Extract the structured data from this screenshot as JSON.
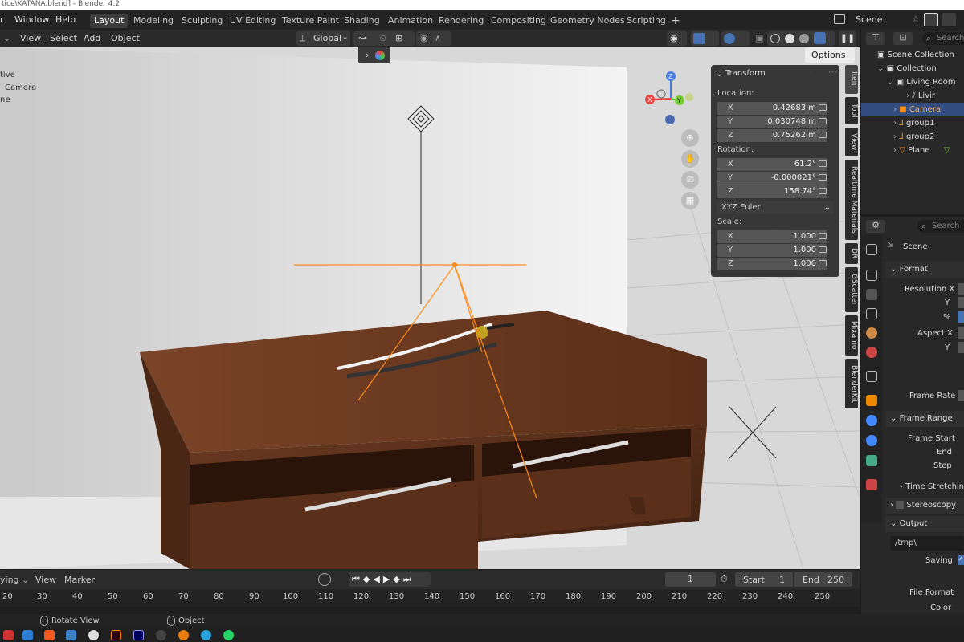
{
  "window": {
    "title": "tice\\KATANA.blend] - Blender 4.2"
  },
  "menus": [
    {
      "label": "r"
    },
    {
      "label": "Window"
    },
    {
      "label": "Help"
    }
  ],
  "workspaces": [
    {
      "label": "Layout",
      "active": true
    },
    {
      "label": "Modeling"
    },
    {
      "label": "Sculpting"
    },
    {
      "label": "UV Editing"
    },
    {
      "label": "Texture Paint"
    },
    {
      "label": "Shading"
    },
    {
      "label": "Animation"
    },
    {
      "label": "Rendering"
    },
    {
      "label": "Compositing"
    },
    {
      "label": "Geometry Nodes"
    },
    {
      "label": "Scripting"
    }
  ],
  "add_workspace_label": "+",
  "scene_selector": {
    "label": "Scene"
  },
  "viewport_header": {
    "view": "View",
    "select": "Select",
    "add": "Add",
    "object": "Object",
    "orientation": "Global"
  },
  "viewport": {
    "options_label": "Options",
    "overlay_text": [
      "tive",
      "Camera",
      "ne"
    ],
    "accent": "#ff8c1a"
  },
  "transform": {
    "title": "Transform",
    "location_label": "Location:",
    "location": [
      {
        "axis": "X",
        "value": "0.42683 m"
      },
      {
        "axis": "Y",
        "value": "0.030748 m"
      },
      {
        "axis": "Z",
        "value": "0.75262 m"
      }
    ],
    "rotation_label": "Rotation:",
    "rotation": [
      {
        "axis": "X",
        "value": "61.2°"
      },
      {
        "axis": "Y",
        "value": "-0.000021°"
      },
      {
        "axis": "Z",
        "value": "158.74°"
      }
    ],
    "rotation_mode": "XYZ Euler",
    "scale_label": "Scale:",
    "scale": [
      {
        "axis": "X",
        "value": "1.000"
      },
      {
        "axis": "Y",
        "value": "1.000"
      },
      {
        "axis": "Z",
        "value": "1.000"
      }
    ]
  },
  "side_tabs": [
    {
      "label": "Item"
    },
    {
      "label": "Tool"
    },
    {
      "label": "View"
    },
    {
      "label": "Realtime Materials"
    },
    {
      "label": "DR"
    },
    {
      "label": "GScatter"
    },
    {
      "label": "Mixamo"
    },
    {
      "label": "BlenderKit"
    }
  ],
  "outliner": {
    "search_placeholder": "Search",
    "rows": [
      {
        "label": "Scene Collection",
        "indent": 0
      },
      {
        "label": "Collection",
        "indent": 1
      },
      {
        "label": "Living Room",
        "indent": 2
      },
      {
        "label": "Livir",
        "indent": 3
      },
      {
        "label": "Camera",
        "indent": 2,
        "selected": true
      },
      {
        "label": "group1",
        "indent": 2
      },
      {
        "label": "group2",
        "indent": 2
      },
      {
        "label": "Plane",
        "indent": 2
      }
    ]
  },
  "properties": {
    "search_placeholder": "Search",
    "context": "Scene",
    "format_section": "Format",
    "resolution_x": "Resolution X",
    "y1": "Y",
    "percent": "%",
    "aspect_x": "Aspect X",
    "y2": "Y",
    "frame_rate": "Frame Rate",
    "frame_range_section": "Frame Range",
    "frame_start": "Frame Start",
    "end": "End",
    "step": "Step",
    "time_stretching": "Time Stretching",
    "stereoscopy": "Stereoscopy",
    "output_section": "Output",
    "output_path": "/tmp\\",
    "saving": "Saving",
    "file_format": "File Format",
    "color": "Color"
  },
  "timeline": {
    "playing_label": "ying",
    "view": "View",
    "marker": "Marker",
    "current_frame": "1",
    "start_label": "Start",
    "start": "1",
    "end_label": "End",
    "end": "250",
    "ticks": [
      "20",
      "30",
      "40",
      "50",
      "60",
      "70",
      "80",
      "90",
      "100",
      "110",
      "120",
      "130",
      "140",
      "150",
      "160",
      "170",
      "180",
      "190",
      "200",
      "210",
      "220",
      "230",
      "240",
      "250"
    ]
  },
  "statusbar": {
    "rotate_view": "Rotate View",
    "object": "Object"
  }
}
